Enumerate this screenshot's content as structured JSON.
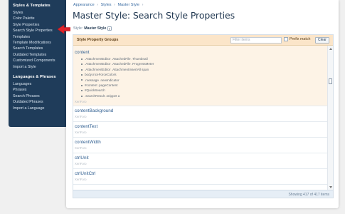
{
  "sidebar": {
    "section1_title": "Styles & Templates",
    "section1_items": [
      "Styles",
      "Color Palette",
      "Style Properties",
      "Search Style Properties",
      "Templates",
      "Template Modifications",
      "Search Templates",
      "Outdated Templates",
      "Customized Components",
      "Import a Style"
    ],
    "section2_title": "Languages & Phrases",
    "section2_items": [
      "Languages",
      "Phrases",
      "Search Phrases",
      "Outdated Phrases",
      "Import a Language"
    ]
  },
  "breadcrumb": [
    "Appearance",
    "Styles",
    "Master Style"
  ],
  "breadcrumb_sep": "›",
  "page_title": "Master Style: Search Style Properties",
  "style_select": {
    "label": "Style:",
    "value": "Master Style"
  },
  "panel": {
    "title": "Style Property Groups",
    "filter_placeholder": "Filter items",
    "prefix_label": "Prefix match",
    "clear_label": "Clear",
    "footer": "Showing 417 of 417 items"
  },
  "items": [
    {
      "name": "content",
      "sub": "XenForo",
      "selectors": [
        ".AttachmentEditor .AttachedFile .Thumbnail",
        ".AttachmentEditor .AttachedFile .ProgressMeter",
        ".AttachmentEditor .AttachmentInsertAll span",
        "body.mceForceColors",
        ".message .newIndicator",
        "#content .pageContent",
        "#QuickSearch",
        ".searchResult .snippet a"
      ]
    },
    {
      "name": "contentBackground",
      "sub": "XenForo"
    },
    {
      "name": "contentText",
      "sub": "XenForo"
    },
    {
      "name": "contentWidth",
      "sub": "XenForo"
    },
    {
      "name": "ctrlUnit",
      "sub": "XenForo"
    },
    {
      "name": "ctrlUnitCtrl",
      "sub": "XenForo"
    }
  ],
  "colors": {
    "sidebar_bg": "#1f3c5a",
    "panel_header_bg": "#fbe5c9",
    "link": "#2f5e90",
    "arrow": "#e0242b"
  }
}
